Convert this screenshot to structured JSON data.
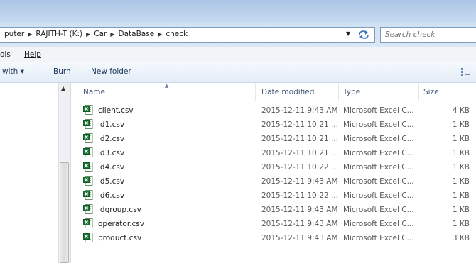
{
  "address": {
    "crumbs": [
      "puter",
      "RAJITH-T (K:)",
      "Car",
      "DataBase",
      "check"
    ]
  },
  "search": {
    "placeholder": "Search check"
  },
  "menu": {
    "tools": "ols",
    "help": "Help"
  },
  "toolbar": {
    "share": "with ▾",
    "burn": "Burn",
    "new_folder": "New folder"
  },
  "columns": {
    "name": "Name",
    "date": "Date modified",
    "type": "Type",
    "size": "Size"
  },
  "files": [
    {
      "name": "client.csv",
      "date": "2015-12-11 9:43 AM",
      "type": "Microsoft Excel C...",
      "size": "4 KB"
    },
    {
      "name": "id1.csv",
      "date": "2015-12-11 10:21 ...",
      "type": "Microsoft Excel C...",
      "size": "1 KB"
    },
    {
      "name": "id2.csv",
      "date": "2015-12-11 10:21 ...",
      "type": "Microsoft Excel C...",
      "size": "1 KB"
    },
    {
      "name": "id3.csv",
      "date": "2015-12-11 10:21 ...",
      "type": "Microsoft Excel C...",
      "size": "1 KB"
    },
    {
      "name": "id4.csv",
      "date": "2015-12-11 10:22 ...",
      "type": "Microsoft Excel C...",
      "size": "1 KB"
    },
    {
      "name": "id5.csv",
      "date": "2015-12-11 9:43 AM",
      "type": "Microsoft Excel C...",
      "size": "1 KB"
    },
    {
      "name": "id6.csv",
      "date": "2015-12-11 10:22 ...",
      "type": "Microsoft Excel C...",
      "size": "1 KB"
    },
    {
      "name": "idgroup.csv",
      "date": "2015-12-11 9:43 AM",
      "type": "Microsoft Excel C...",
      "size": "1 KB"
    },
    {
      "name": "operator.csv",
      "date": "2015-12-11 9:43 AM",
      "type": "Microsoft Excel C...",
      "size": "1 KB"
    },
    {
      "name": "product.csv",
      "date": "2015-12-11 9:43 AM",
      "type": "Microsoft Excel C...",
      "size": "3 KB"
    }
  ],
  "icons": {
    "file": "excel-csv-icon",
    "refresh": "refresh-icon",
    "view": "view-options-icon"
  },
  "colors": {
    "accent": "#1e395b",
    "header_text": "#4c607a",
    "excel_green": "#1f7a3a"
  }
}
